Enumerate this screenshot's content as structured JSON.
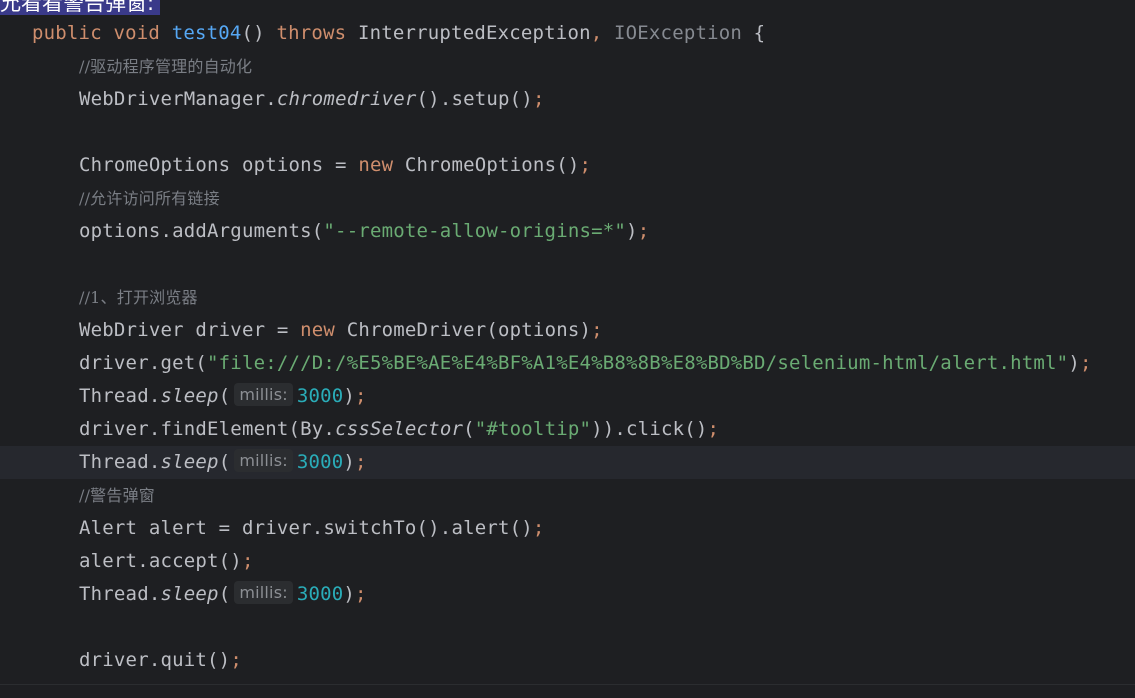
{
  "banner": {
    "text": "允看看警告弹窗:"
  },
  "code": {
    "l1": {
      "kw_public": "public",
      "kw_void": "void",
      "method": "test04",
      "paren": "()",
      "kw_throws": "throws",
      "ex1": "InterruptedException",
      "comma": ",",
      "ex2": "IOException",
      "brace": "{"
    },
    "l2": {
      "comment": "//驱动程序管理的自动化"
    },
    "l3": {
      "cls": "WebDriverManager.",
      "call": "chromedriver",
      "rest": "().setup()",
      "semi": ";"
    },
    "l5": {
      "type": "ChromeOptions options = ",
      "kw_new": "new",
      "ctor": "ChromeOptions()",
      "semi": ";"
    },
    "l6": {
      "comment": "//允许访问所有链接"
    },
    "l7": {
      "pre": "options.addArguments(",
      "str": "\"--remote-allow-origins=*\"",
      "post": ")",
      "semi": ";"
    },
    "l9": {
      "comment": "//1、打开浏览器"
    },
    "l10": {
      "type": "WebDriver driver = ",
      "kw_new": "new",
      "ctor": "ChromeDriver(options)",
      "semi": ";"
    },
    "l11": {
      "pre": "driver.get(",
      "str": "\"file:///D:/%E5%BE%AE%E4%BF%A1%E4%B8%8B%E8%BD%BD/selenium-html/alert.html\"",
      "post": ")",
      "semi": ";"
    },
    "l12": {
      "cls": "Thread.",
      "call": "sleep",
      "open": "(",
      "hint": "millis:",
      "num": "3000",
      "close": ")",
      "semi": ";"
    },
    "l13": {
      "pre": "driver.findElement(By.",
      "call": "cssSelector",
      "open": "(",
      "str": "\"#tooltip\"",
      "post": ")).click()",
      "semi": ";"
    },
    "l14": {
      "cls": "Thread.",
      "call": "sleep",
      "open": "(",
      "hint": "millis:",
      "num": "3000",
      "close": ")",
      "semi": ";"
    },
    "l15": {
      "comment": "//警告弹窗"
    },
    "l16": {
      "pre": "Alert alert = driver.switchTo().alert()",
      "semi": ";"
    },
    "l17": {
      "pre": "alert.accept()",
      "semi": ";"
    },
    "l18": {
      "cls": "Thread.",
      "call": "sleep",
      "open": "(",
      "hint": "millis:",
      "num": "3000",
      "close": ")",
      "semi": ";"
    },
    "l20": {
      "pre": "driver.quit()",
      "semi": ";"
    }
  },
  "colors": {
    "background": "#1e1f22",
    "keyword": "#cf8e6d",
    "method_decl": "#56a8f5",
    "identifier": "#bcbec4",
    "string": "#6aab73",
    "number": "#2aacb8",
    "comment": "#7a7e85",
    "current_line": "#26282e"
  }
}
